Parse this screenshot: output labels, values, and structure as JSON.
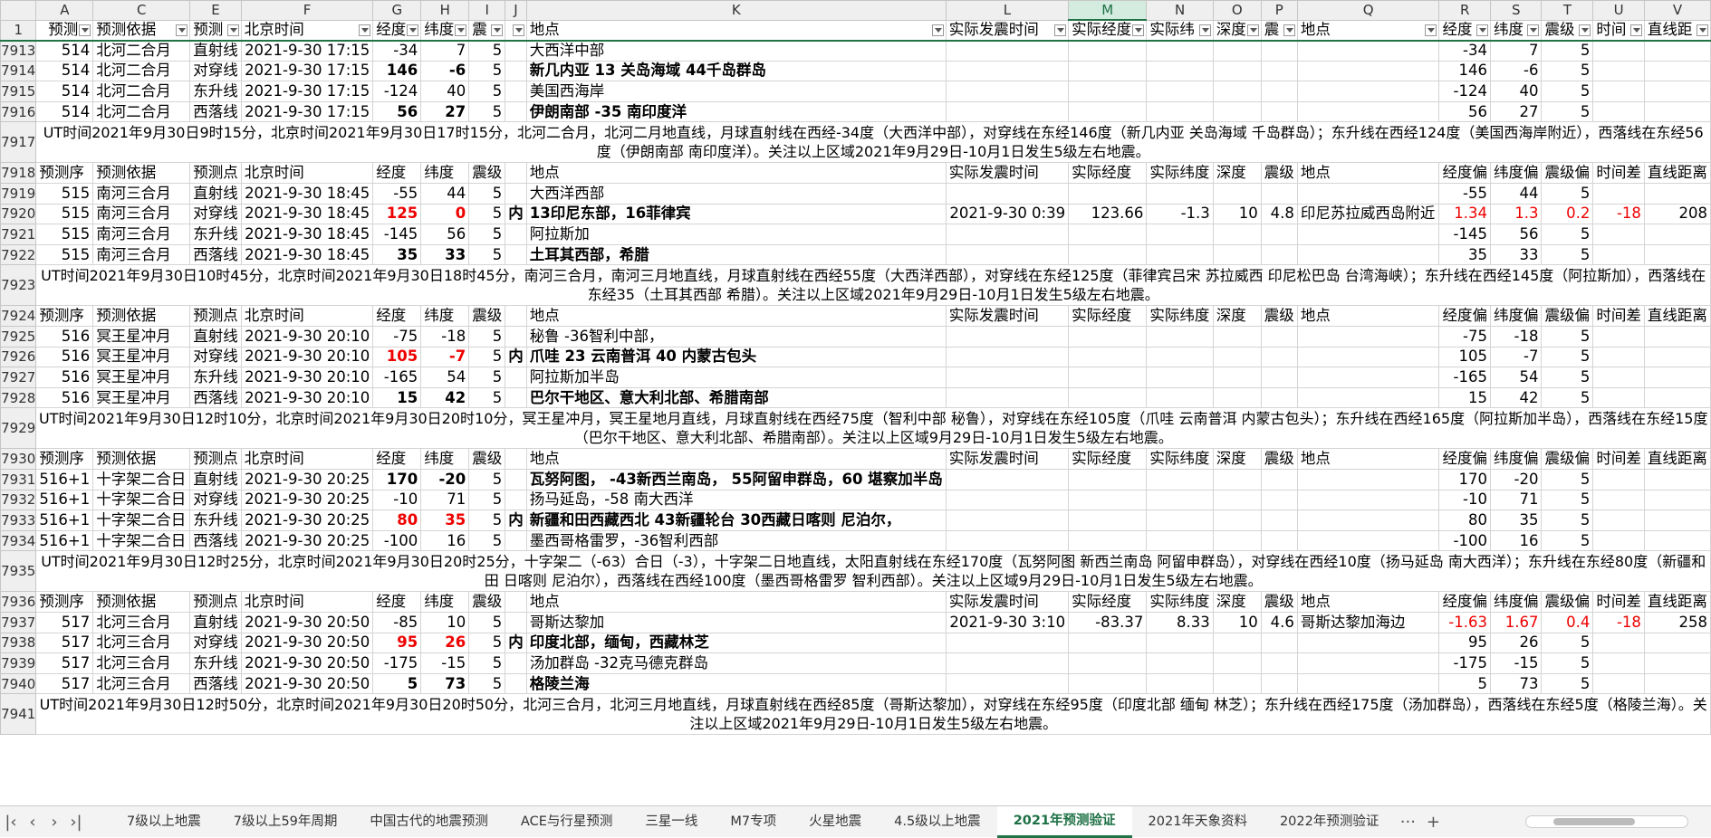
{
  "columns": [
    "A",
    "C",
    "E",
    "F",
    "G",
    "H",
    "I",
    "J",
    "K",
    "L",
    "M",
    "N",
    "O",
    "P",
    "Q",
    "R",
    "S",
    "T",
    "U",
    "V"
  ],
  "header_row": {
    "num": "1",
    "cells": [
      "预测",
      "预测依据",
      "预测",
      "北京时间",
      "经度",
      "纬度",
      "震",
      "",
      "地点",
      "实际发震时间",
      "实际经度",
      "实际纬",
      "深度",
      "震",
      "地点",
      "经度",
      "纬度",
      "震级",
      "时间",
      "直线距"
    ]
  },
  "subheader": [
    "预测序",
    "预测依据",
    "预测点",
    "北京时间",
    "经度",
    "纬度",
    "震级",
    "",
    "地点",
    "实际发震时间",
    "实际经度",
    "实际纬度",
    "深度",
    "震级",
    "地点",
    "经度偏",
    "纬度偏",
    "震级偏",
    "时间差",
    "直线距离"
  ],
  "groups": [
    {
      "head": null,
      "rows": [
        {
          "n": "7913",
          "a": "514",
          "c": "北河二合月",
          "e": "直射线",
          "f": "2021-9-30 17:15",
          "g": "-34",
          "h": "7",
          "i": "5",
          "j": "",
          "k": "大西洋中部",
          "kb": false,
          "red": false,
          "r": "-34",
          "s": "7",
          "t": "5"
        },
        {
          "n": "7914",
          "a": "514",
          "c": "北河二合月",
          "e": "对穿线",
          "f": "2021-9-30 17:15",
          "g": "146",
          "h": "-6",
          "i": "5",
          "j": "",
          "k": "新几内亚 13 关岛海域 44千岛群岛",
          "kb": true,
          "red": false,
          "r": "146",
          "s": "-6",
          "t": "5"
        },
        {
          "n": "7915",
          "a": "514",
          "c": "北河二合月",
          "e": "东升线",
          "f": "2021-9-30 17:15",
          "g": "-124",
          "h": "40",
          "i": "5",
          "j": "",
          "k": "美国西海岸",
          "kb": false,
          "red": false,
          "r": "-124",
          "s": "40",
          "t": "5"
        },
        {
          "n": "7916",
          "a": "514",
          "c": "北河二合月",
          "e": "西落线",
          "f": "2021-9-30 17:15",
          "g": "56",
          "h": "27",
          "i": "5",
          "j": "",
          "k": "伊朗南部 -35 南印度洋",
          "kb": true,
          "red": false,
          "r": "56",
          "s": "27",
          "t": "5"
        }
      ],
      "note": {
        "n": "7917",
        "text": "UT时间2021年9月30日9时15分，北京时间2021年9月30日17时15分，北河二合月，北河二月地直线，月球直射线在西经-34度（大西洋中部），对穿线在东经146度（新几内亚 关岛海域 千岛群岛）；东升线在西经124度（美国西海岸附近），西落线在东经56度（伊朗南部 南印度洋）。关注以上区域2021年9月29日-10月1日发生5级左右地震。"
      }
    },
    {
      "head": "7918",
      "rows": [
        {
          "n": "7919",
          "a": "515",
          "c": "南河三合月",
          "e": "直射线",
          "f": "2021-9-30 18:45",
          "g": "-55",
          "h": "44",
          "i": "5",
          "j": "",
          "k": "大西洋西部",
          "kb": false,
          "red": false,
          "r": "-55",
          "s": "44",
          "t": "5"
        },
        {
          "n": "7920",
          "a": "515",
          "c": "南河三合月",
          "e": "对穿线",
          "f": "2021-9-30 18:45",
          "g": "125",
          "h": "0",
          "i": "5",
          "j": "内",
          "k": "13印尼东部，16菲律宾",
          "kb": true,
          "red": true,
          "l": "2021-9-30 0:39",
          "m": "123.66",
          "nn": "-1.3",
          "o": "10",
          "p": "4.8",
          "q": "印尼苏拉威西岛附近",
          "r": "1.34",
          "s": "1.3",
          "t": "0.2",
          "u": "-18",
          "v": "208"
        },
        {
          "n": "7921",
          "a": "515",
          "c": "南河三合月",
          "e": "东升线",
          "f": "2021-9-30 18:45",
          "g": "-145",
          "h": "56",
          "i": "5",
          "j": "",
          "k": "阿拉斯加",
          "kb": false,
          "red": false,
          "r": "-145",
          "s": "56",
          "t": "5"
        },
        {
          "n": "7922",
          "a": "515",
          "c": "南河三合月",
          "e": "西落线",
          "f": "2021-9-30 18:45",
          "g": "35",
          "h": "33",
          "i": "5",
          "j": "",
          "k": "土耳其西部，希腊",
          "kb": true,
          "red": false,
          "r": "35",
          "s": "33",
          "t": "5"
        }
      ],
      "note": {
        "n": "7923",
        "text": "UT时间2021年9月30日10时45分，北京时间2021年9月30日18时45分，南河三合月，南河三月地直线，月球直射线在西经55度（大西洋西部），对穿线在东经125度（菲律宾吕宋 苏拉威西 印尼松巴岛 台湾海峡）；东升线在西经145度（阿拉斯加），西落线在东经35（土耳其西部 希腊）。关注以上区域2021年9月29日-10月1日发生5级左右地震。"
      }
    },
    {
      "head": "7924",
      "rows": [
        {
          "n": "7925",
          "a": "516",
          "c": "冥王星冲月",
          "e": "直射线",
          "f": "2021-9-30 20:10",
          "g": "-75",
          "h": "-18",
          "i": "5",
          "j": "",
          "k": "秘鲁 -36智利中部，",
          "kb": false,
          "red": false,
          "r": "-75",
          "s": "-18",
          "t": "5"
        },
        {
          "n": "7926",
          "a": "516",
          "c": "冥王星冲月",
          "e": "对穿线",
          "f": "2021-9-30 20:10",
          "g": "105",
          "h": "-7",
          "i": "5",
          "j": "内",
          "k": "爪哇 23 云南普洱 40 内蒙古包头",
          "kb": true,
          "red": true,
          "r": "105",
          "s": "-7",
          "t": "5"
        },
        {
          "n": "7927",
          "a": "516",
          "c": "冥王星冲月",
          "e": "东升线",
          "f": "2021-9-30 20:10",
          "g": "-165",
          "h": "54",
          "i": "5",
          "j": "",
          "k": "阿拉斯加半岛",
          "kb": false,
          "red": false,
          "r": "-165",
          "s": "54",
          "t": "5"
        },
        {
          "n": "7928",
          "a": "516",
          "c": "冥王星冲月",
          "e": "西落线",
          "f": "2021-9-30 20:10",
          "g": "15",
          "h": "42",
          "i": "5",
          "j": "",
          "k": "巴尔干地区、意大利北部、希腊南部",
          "kb": true,
          "red": false,
          "r": "15",
          "s": "42",
          "t": "5"
        }
      ],
      "note": {
        "n": "7929",
        "text": "UT时间2021年9月30日12时10分，北京时间2021年9月30日20时10分，冥王星冲月，冥王星地月直线，月球直射线在西经75度（智利中部 秘鲁），对穿线在东经105度（爪哇 云南普洱 内蒙古包头）；东升线在西经165度（阿拉斯加半岛），西落线在东经15度（巴尔干地区、意大利北部、希腊南部）。关注以上区域9月29日-10月1日发生5级左右地震。"
      }
    },
    {
      "head": "7930",
      "rows": [
        {
          "n": "7931",
          "a": "516+1",
          "c": "十字架二合日",
          "e": "直射线",
          "f": "2021-9-30 20:25",
          "g": "170",
          "h": "-20",
          "i": "5",
          "j": "",
          "k": "瓦努阿图， -43新西兰南岛， 55阿留申群岛，60 堪察加半岛",
          "kb": true,
          "red": false,
          "r": "170",
          "s": "-20",
          "t": "5"
        },
        {
          "n": "7932",
          "a": "516+1",
          "c": "十字架二合日",
          "e": "对穿线",
          "f": "2021-9-30 20:25",
          "g": "-10",
          "h": "71",
          "i": "5",
          "j": "",
          "k": "扬马延岛，-58 南大西洋",
          "kb": false,
          "red": false,
          "r": "-10",
          "s": "71",
          "t": "5"
        },
        {
          "n": "7933",
          "a": "516+1",
          "c": "十字架二合日",
          "e": "东升线",
          "f": "2021-9-30 20:25",
          "g": "80",
          "h": "35",
          "i": "5",
          "j": "内",
          "k": "新疆和田西藏西北 43新疆轮台 30西藏日喀则 尼泊尔，",
          "kb": true,
          "red": true,
          "r": "80",
          "s": "35",
          "t": "5"
        },
        {
          "n": "7934",
          "a": "516+1",
          "c": "十字架二合日",
          "e": "西落线",
          "f": "2021-9-30 20:25",
          "g": "-100",
          "h": "16",
          "i": "5",
          "j": "",
          "k": "墨西哥格雷罗，-36智利西部",
          "kb": false,
          "red": false,
          "r": "-100",
          "s": "16",
          "t": "5"
        }
      ],
      "note": {
        "n": "7935",
        "text": "UT时间2021年9月30日12时25分，北京时间2021年9月30日20时25分，十字架二（-63）合日（-3），十字架二日地直线，太阳直射线在东经170度（瓦努阿图 新西兰南岛 阿留申群岛），对穿线在西经10度（扬马延岛 南大西洋）；东升线在东经80度（新疆和田 日喀则 尼泊尔），西落线在西经100度（墨西哥格雷罗 智利西部）。关注以上区域9月29日-10月1日发生5级左右地震。"
      }
    },
    {
      "head": "7936",
      "rows": [
        {
          "n": "7937",
          "a": "517",
          "c": "北河三合月",
          "e": "直射线",
          "f": "2021-9-30 20:50",
          "g": "-85",
          "h": "10",
          "i": "5",
          "j": "",
          "k": "哥斯达黎加",
          "kb": false,
          "red": false,
          "l": "2021-9-30 3:10",
          "m": "-83.37",
          "nn": "8.33",
          "o": "10",
          "p": "4.6",
          "q": "哥斯达黎加海边",
          "r": "-1.63",
          "s": "1.67",
          "t": "0.4",
          "u": "-18",
          "v": "258"
        },
        {
          "n": "7938",
          "a": "517",
          "c": "北河三合月",
          "e": "对穿线",
          "f": "2021-9-30 20:50",
          "g": "95",
          "h": "26",
          "i": "5",
          "j": "内",
          "k": "印度北部，缅甸，西藏林芝",
          "kb": true,
          "red": true,
          "r": "95",
          "s": "26",
          "t": "5"
        },
        {
          "n": "7939",
          "a": "517",
          "c": "北河三合月",
          "e": "东升线",
          "f": "2021-9-30 20:50",
          "g": "-175",
          "h": "-15",
          "i": "5",
          "j": "",
          "k": "汤加群岛 -32克马德克群岛",
          "kb": false,
          "red": false,
          "r": "-175",
          "s": "-15",
          "t": "5"
        },
        {
          "n": "7940",
          "a": "517",
          "c": "北河三合月",
          "e": "西落线",
          "f": "2021-9-30 20:50",
          "g": "5",
          "h": "73",
          "i": "5",
          "j": "",
          "k": "格陵兰海",
          "kb": true,
          "red": false,
          "r": "5",
          "s": "73",
          "t": "5"
        }
      ],
      "note": {
        "n": "7941",
        "text": "UT时间2021年9月30日12时50分，北京时间2021年9月30日20时50分，北河三合月，北河三月地直线，月球直射线在西经85度（哥斯达黎加），对穿线在东经95度（印度北部 缅甸 林芝）；东升线在西经175度（汤加群岛），西落线在东经5度（格陵兰海）。关注以上区域2021年9月29日-10月1日发生5级左右地震。"
      }
    }
  ],
  "tabs": [
    "7级以上地震",
    "7级以上59年周期",
    "中国古代的地震预测",
    "ACE与行星预测",
    "三星一线",
    "M7专项",
    "火星地震",
    "4.5级以上地震",
    "2021年预测验证",
    "2021年天象资料",
    "2022年预测验证"
  ],
  "active_tab": "2021年预测验证",
  "more_tabs": "···",
  "add_sheet": "+",
  "selected_column": "M"
}
